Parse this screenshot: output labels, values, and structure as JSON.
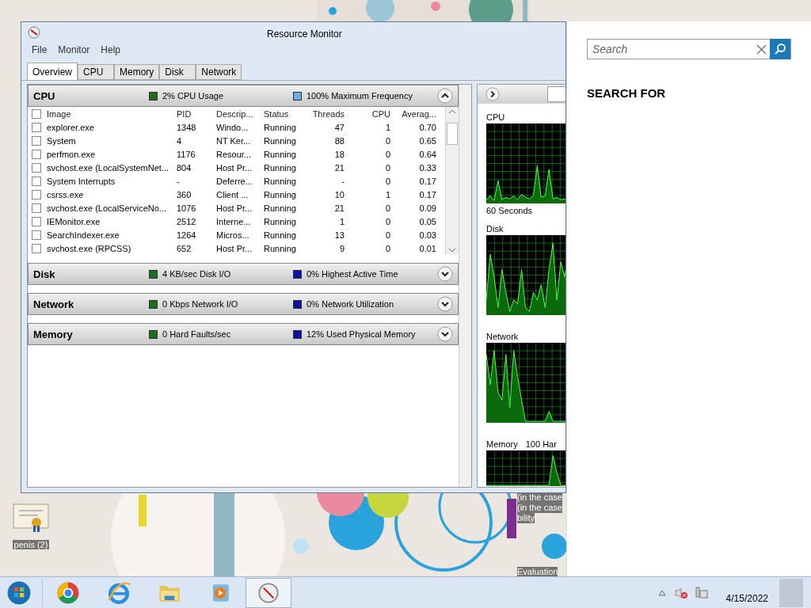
{
  "desktop": {
    "icon_label": "penis (2)",
    "notice_lines": [
      "(in the case",
      "(in the case",
      "bility",
      "Evaluation"
    ]
  },
  "window": {
    "title": "Resource Monitor",
    "menu": [
      "File",
      "Monitor",
      "Help"
    ],
    "tabs": [
      {
        "label": "Overview",
        "selected": true
      },
      {
        "label": "CPU",
        "selected": false
      },
      {
        "label": "Memory",
        "selected": false
      },
      {
        "label": "Disk",
        "selected": false
      },
      {
        "label": "Network",
        "selected": false
      }
    ],
    "sections": [
      {
        "title": "CPU",
        "expanded": true,
        "stats": [
          {
            "text": "2% CPU Usage",
            "color": "#1f6b1f"
          },
          {
            "text": "100% Maximum Frequency",
            "color": "#6aaee8"
          }
        ],
        "table": {
          "header_checked": false,
          "columns": [
            {
              "label": "Image"
            },
            {
              "label": "PID"
            },
            {
              "label": "Descrip..."
            },
            {
              "label": "Status"
            },
            {
              "label": "Threads"
            },
            {
              "label": "CPU"
            },
            {
              "label": "Averag..."
            }
          ],
          "rows": [
            {
              "checked": false,
              "cells": [
                "explorer.exe",
                "1348",
                "Windo...",
                "Running",
                "47",
                "1",
                "0.70"
              ]
            },
            {
              "checked": false,
              "cells": [
                "System",
                "4",
                "NT Ker...",
                "Running",
                "88",
                "0",
                "0.65"
              ]
            },
            {
              "checked": false,
              "cells": [
                "perfmon.exe",
                "1176",
                "Resour...",
                "Running",
                "18",
                "0",
                "0.64"
              ]
            },
            {
              "checked": false,
              "cells": [
                "svchost.exe (LocalSystemNet...",
                "804",
                "Host Pr...",
                "Running",
                "21",
                "0",
                "0.33"
              ]
            },
            {
              "checked": false,
              "cells": [
                "System Interrupts",
                "-",
                "Deferre...",
                "Running",
                "-",
                "0",
                "0.17"
              ]
            },
            {
              "checked": false,
              "cells": [
                "csrss.exe",
                "360",
                "Client ...",
                "Running",
                "10",
                "1",
                "0.17"
              ]
            },
            {
              "checked": false,
              "cells": [
                "svchost.exe (LocalServiceNo...",
                "1076",
                "Host Pr...",
                "Running",
                "21",
                "0",
                "0.09"
              ]
            },
            {
              "checked": false,
              "cells": [
                "IEMonitor.exe",
                "2512",
                "Interne...",
                "Running",
                "1",
                "0",
                "0.05"
              ]
            },
            {
              "checked": false,
              "cells": [
                "SearchIndexer.exe",
                "1264",
                "Micros...",
                "Running",
                "13",
                "0",
                "0.03"
              ]
            },
            {
              "checked": false,
              "cells": [
                "svchost.exe (RPCSS)",
                "652",
                "Host Pr...",
                "Running",
                "9",
                "0",
                "0.01"
              ]
            }
          ]
        }
      },
      {
        "title": "Disk",
        "expanded": false,
        "stats": [
          {
            "text": "4 KB/sec Disk I/O",
            "color": "#1f6b1f"
          },
          {
            "text": "0% Highest Active Time",
            "color": "#1010a8"
          }
        ]
      },
      {
        "title": "Network",
        "expanded": false,
        "stats": [
          {
            "text": "0 Kbps Network I/O",
            "color": "#1f6b1f"
          },
          {
            "text": "0% Network Utilization",
            "color": "#1010a8"
          }
        ]
      },
      {
        "title": "Memory",
        "expanded": false,
        "stats": [
          {
            "text": "0 Hard Faults/sec",
            "color": "#1f6b1f"
          },
          {
            "text": "12% Used Physical Memory",
            "color": "#1010a8"
          }
        ]
      }
    ],
    "graphs": [
      {
        "title": "CPU",
        "caption": "60 Seconds"
      },
      {
        "title": "Disk"
      },
      {
        "title": "Network"
      },
      {
        "title": "Memory",
        "note": "100 Har"
      }
    ]
  },
  "search_pane": {
    "placeholder": "Search",
    "heading": "SEARCH FOR"
  },
  "taskbar": {
    "date": "4/15/2022"
  }
}
